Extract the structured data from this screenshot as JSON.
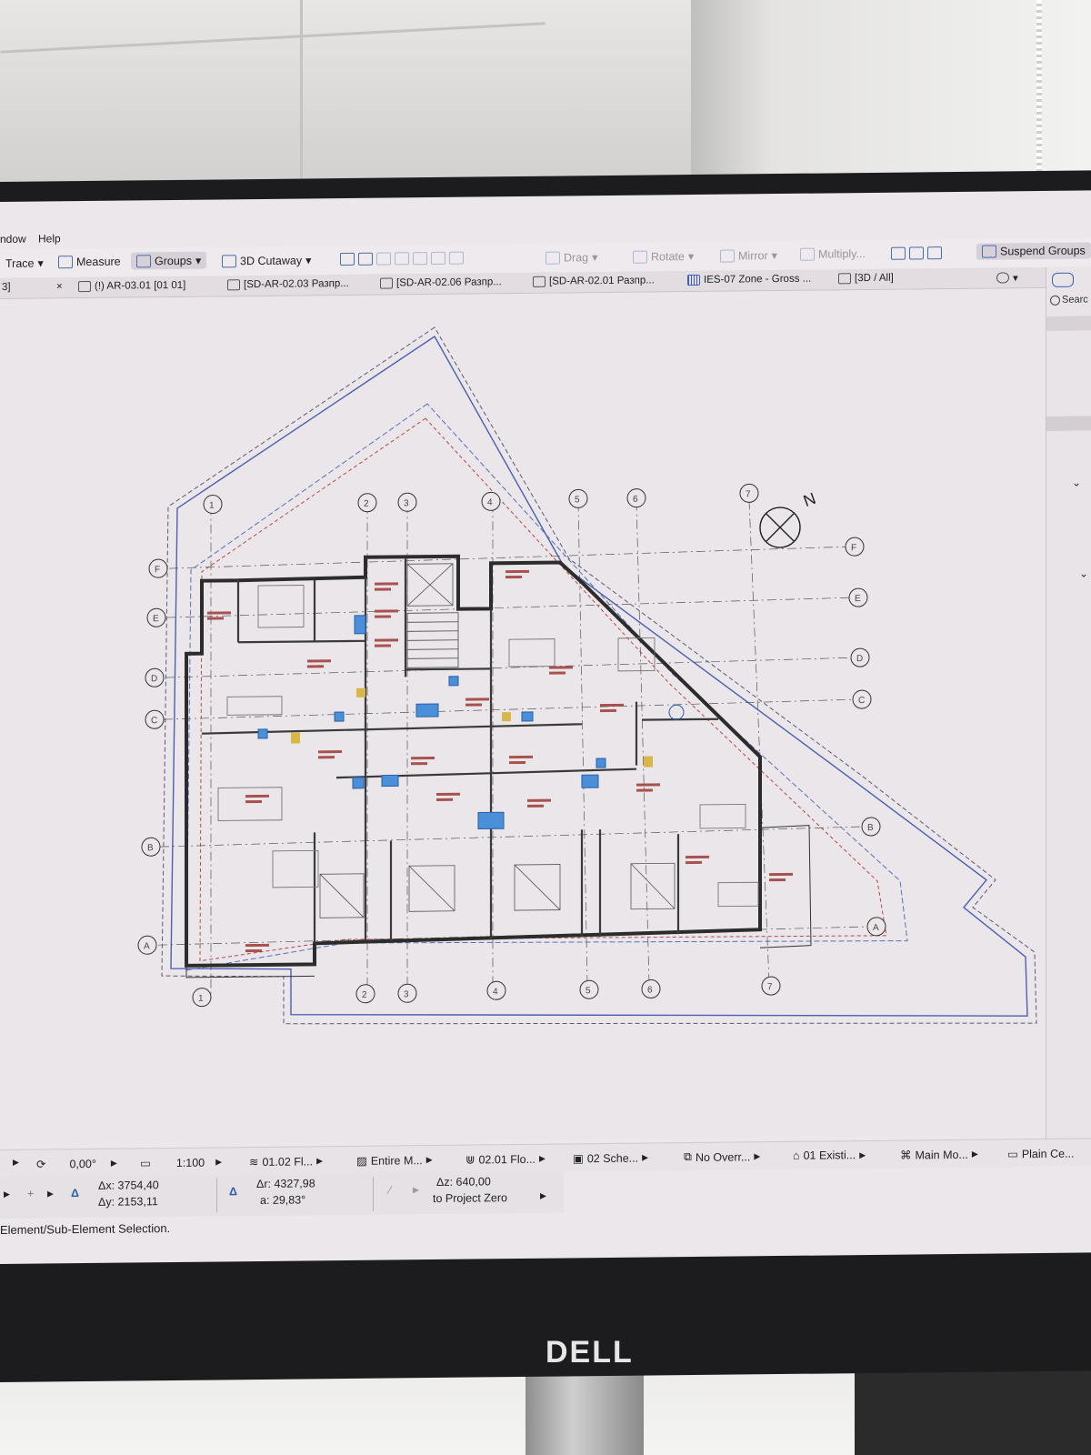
{
  "menu": {
    "window_label": "ndow",
    "help_label": "Help"
  },
  "toolbar": {
    "trace": "Trace",
    "measure": "Measure",
    "groups": "Groups",
    "cutaway": "3D Cutaway",
    "drag": "Drag",
    "rotate": "Rotate",
    "mirror": "Mirror",
    "multiply": "Multiply...",
    "suspend_groups": "Suspend Groups"
  },
  "tabs": {
    "left_fragment": "3]",
    "close_glyph": "×",
    "items": [
      "(!) AR-03.01 [01 01]",
      "[SD-AR-02.03 Разпр...",
      "[SD-AR-02.06 Разпр...",
      "[SD-AR-02.01 Разпр...",
      "IES-07 Zone - Gross ...",
      "[3D / All]"
    ]
  },
  "right_panel": {
    "search": "Searc"
  },
  "plan": {
    "grid_numbers": [
      "1",
      "2",
      "3",
      "4",
      "5",
      "6",
      "7"
    ],
    "grid_letters": [
      "F",
      "E",
      "D",
      "C",
      "B",
      "A"
    ],
    "north": "N"
  },
  "statusbar": {
    "angle": "0,00°",
    "scale": "1:100",
    "layer": "01.02 Fl...",
    "model": "Entire M...",
    "floor": "02.01 Flo...",
    "scheme": "02 Sche...",
    "override": "No Overr...",
    "existing": "01 Existi...",
    "main": "Main Mo...",
    "plain": "Plain Ce..."
  },
  "coords": {
    "dx": "Δx: 3754,40",
    "dy": "Δy: 2153,11",
    "dr": "Δr: 4327,98",
    "a": "a: 29,83°",
    "dz": "Δz: 640,00",
    "zero": "to Project Zero"
  },
  "hint": "Element/Sub-Element Selection.",
  "brand": "DELL",
  "colors": {
    "wall": "#3a3a3a",
    "blue_line": "#4b5fb3",
    "red_dash": "#b24b4b",
    "fixture_blue": "#4a90d9",
    "furniture_red": "#a8524f"
  }
}
